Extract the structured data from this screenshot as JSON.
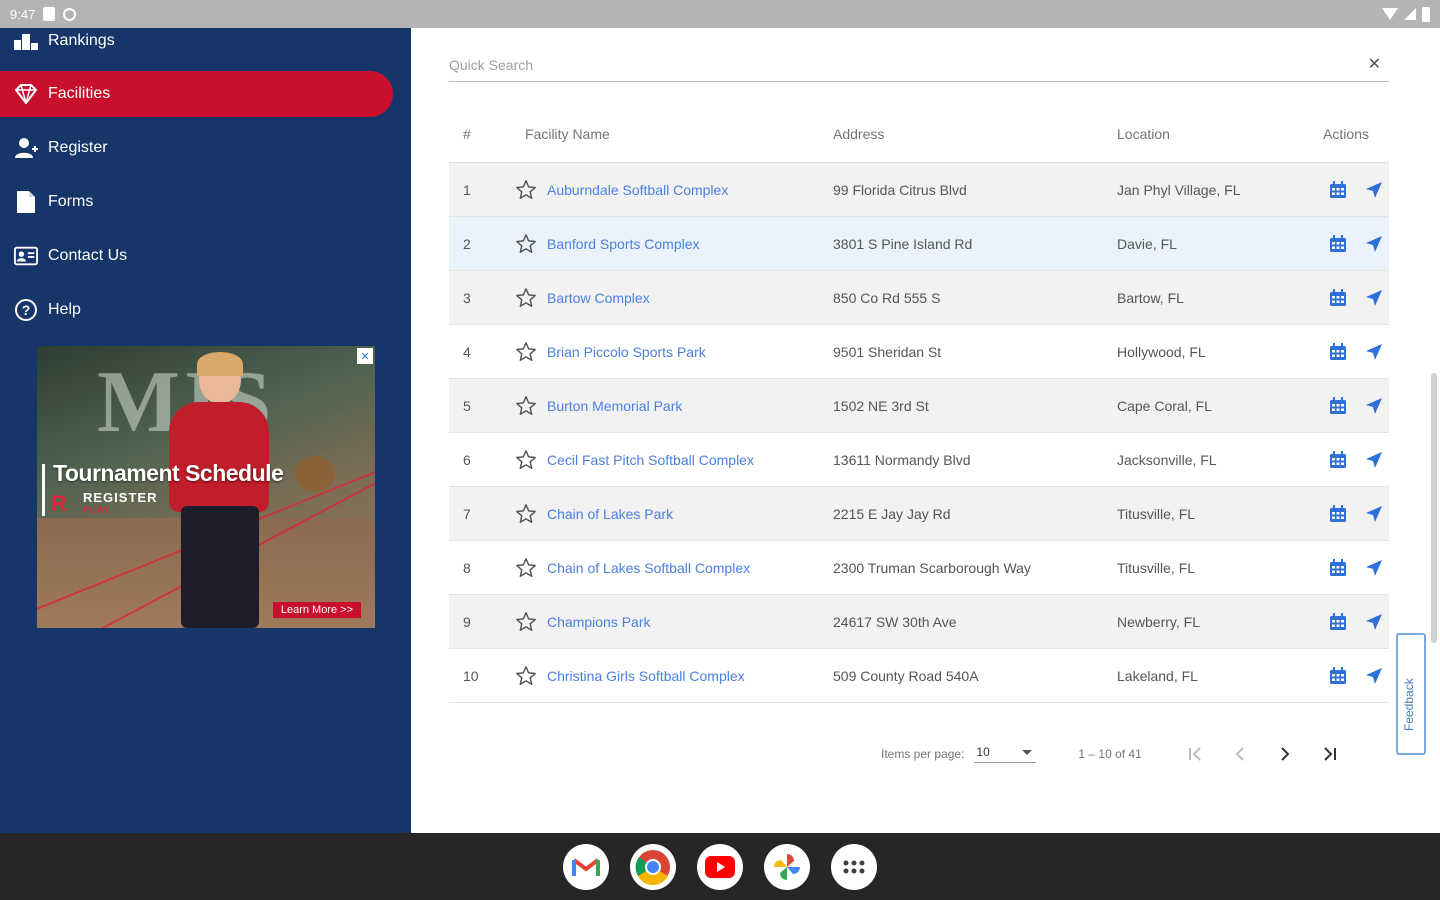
{
  "status_bar": {
    "time": "9:47"
  },
  "sidebar": {
    "items": [
      {
        "label": "Rankings"
      },
      {
        "label": "Facilities"
      },
      {
        "label": "Register"
      },
      {
        "label": "Forms"
      },
      {
        "label": "Contact Us"
      },
      {
        "label": "Help"
      }
    ],
    "active_item": "Facilities",
    "ad": {
      "title": "Tournament Schedule",
      "brand": "REGISTER",
      "brand_sub": "PLAY",
      "button": "Learn More >>",
      "background_text": "MIS"
    }
  },
  "search": {
    "placeholder": "Quick Search",
    "value": ""
  },
  "table": {
    "headers": {
      "num": "#",
      "name": "Facility Name",
      "address": "Address",
      "location": "Location",
      "actions": "Actions"
    },
    "rows": [
      {
        "num": "1",
        "name": "Auburndale Softball Complex",
        "address": "99 Florida Citrus Blvd",
        "location": "Jan Phyl Village, FL"
      },
      {
        "num": "2",
        "name": "Banford Sports Complex",
        "address": "3801 S Pine Island Rd",
        "location": "Davie, FL"
      },
      {
        "num": "3",
        "name": "Bartow Complex",
        "address": "850 Co Rd 555 S",
        "location": "Bartow, FL"
      },
      {
        "num": "4",
        "name": "Brian Piccolo Sports Park",
        "address": "9501 Sheridan St",
        "location": "Hollywood, FL"
      },
      {
        "num": "5",
        "name": "Burton Memorial Park",
        "address": "1502 NE 3rd St",
        "location": "Cape Coral, FL"
      },
      {
        "num": "6",
        "name": "Cecil Fast Pitch Softball Complex",
        "address": "13611 Normandy Blvd",
        "location": "Jacksonville, FL"
      },
      {
        "num": "7",
        "name": "Chain of Lakes Park",
        "address": "2215 E Jay Jay Rd",
        "location": "Titusville, FL"
      },
      {
        "num": "8",
        "name": "Chain of Lakes Softball Complex",
        "address": "2300 Truman Scarborough Way",
        "location": "Titusville, FL"
      },
      {
        "num": "9",
        "name": "Champions Park",
        "address": "24617 SW 30th Ave",
        "location": "Newberry, FL"
      },
      {
        "num": "10",
        "name": "Christina Girls Softball Complex",
        "address": "509 County Road 540A",
        "location": "Lakeland, FL"
      }
    ],
    "highlighted_row": 2
  },
  "pagination": {
    "items_label": "Items per page:",
    "items_per_page": "10",
    "range": "1 – 10 of 41"
  },
  "feedback": {
    "label": "Feedback"
  },
  "colors": {
    "sidebar": "#163569",
    "active": "#c8102e",
    "link": "#4a7fe0",
    "icon": "#2f6fd8",
    "taskbar": "#262626"
  },
  "taskbar": {
    "apps": [
      "gmail-icon",
      "chrome-icon",
      "youtube-icon",
      "photos-icon",
      "app-launcher-icon"
    ]
  }
}
